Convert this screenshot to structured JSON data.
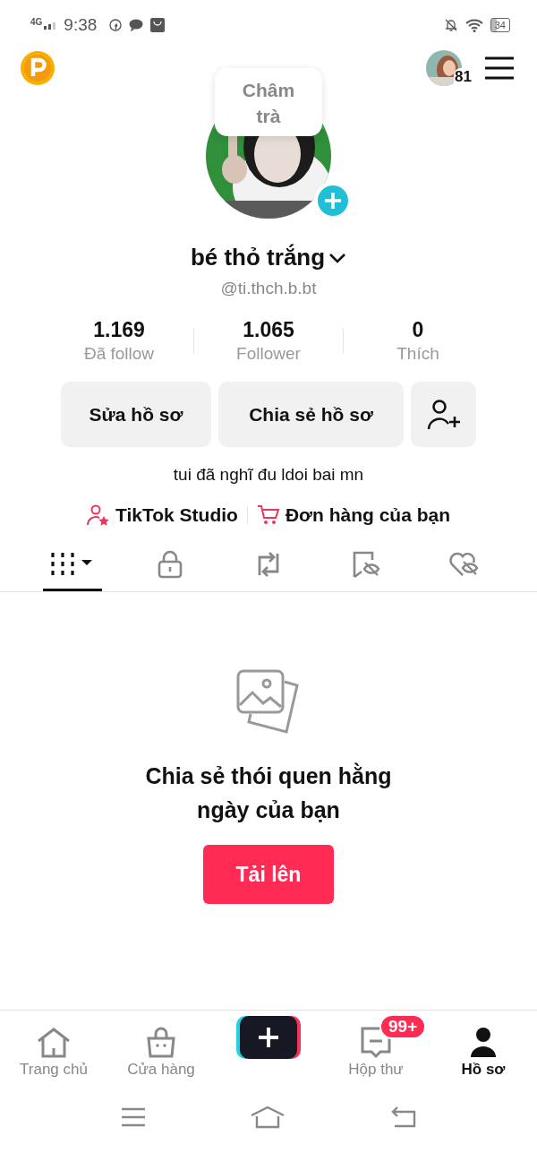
{
  "status_bar": {
    "network": "4G",
    "time": "9:38",
    "battery": "34"
  },
  "top_bar": {
    "friend_count": "81"
  },
  "profile": {
    "note": "Châm trà",
    "name": "bé thỏ trắng",
    "handle": "@ti.thch.b.bt",
    "stats": [
      {
        "value": "1.169",
        "label": "Đã follow"
      },
      {
        "value": "1.065",
        "label": "Follower"
      },
      {
        "value": "0",
        "label": "Thích"
      }
    ],
    "buttons": [
      "Sửa hồ sơ",
      "Chia sẻ hồ sơ"
    ],
    "bio": "tui đã nghĩ đu ldoi bai mn",
    "links": [
      {
        "kind": "studio",
        "label": "TikTok Studio"
      },
      {
        "kind": "orders",
        "label": "Đơn hàng của bạn"
      }
    ]
  },
  "tabs": [
    {
      "kind": "videos",
      "selected": true
    },
    {
      "kind": "private",
      "selected": false
    },
    {
      "kind": "reposts",
      "selected": false
    },
    {
      "kind": "saved",
      "selected": false
    },
    {
      "kind": "liked",
      "selected": false
    }
  ],
  "empty_state": {
    "message": "Chia sẻ thói quen hằng ngày của bạn",
    "button": "Tải lên"
  },
  "bottom_nav": [
    {
      "kind": "home",
      "label": "Trang chủ",
      "selected": false
    },
    {
      "kind": "shop",
      "label": "Cửa hàng",
      "selected": false
    },
    {
      "kind": "create",
      "selected": false
    },
    {
      "kind": "inbox",
      "label": "Hộp thư",
      "badge": "99+",
      "selected": false
    },
    {
      "kind": "profile",
      "label": "Hồ sơ",
      "selected": true
    }
  ]
}
